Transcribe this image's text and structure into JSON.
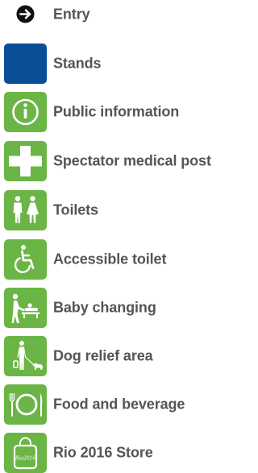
{
  "colors": {
    "green": "#6ab545",
    "blue": "#0a4e96",
    "label": "#555555"
  },
  "legend": {
    "items": [
      {
        "label": "Entry",
        "icon": "arrow-right-circle-icon"
      },
      {
        "label": "Stands",
        "icon": "blue-square-icon"
      },
      {
        "label": "Public information",
        "icon": "information-icon"
      },
      {
        "label": "Spectator medical post",
        "icon": "medical-cross-icon"
      },
      {
        "label": "Toilets",
        "icon": "toilets-icon"
      },
      {
        "label": "Accessible toilet",
        "icon": "wheelchair-icon"
      },
      {
        "label": "Baby changing",
        "icon": "baby-changing-icon"
      },
      {
        "label": "Dog relief area",
        "icon": "dog-relief-icon"
      },
      {
        "label": "Food and beverage",
        "icon": "food-beverage-icon"
      },
      {
        "label": "Rio 2016 Store",
        "icon": "store-bag-icon"
      }
    ],
    "store_bag_text": "Rio2016"
  }
}
